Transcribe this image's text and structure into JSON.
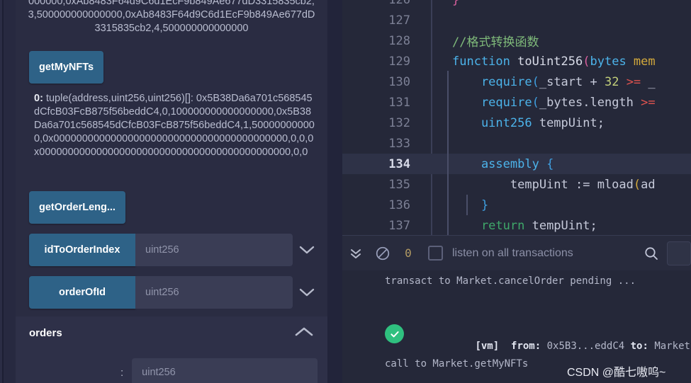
{
  "left_panel": {
    "top_result_text": "000000,0xAb8483F64d9C6d1EcF9b849Ae677dD3315835cb2,3,500000000000000,0xAb8483F64d9C6d1EcF9b849Ae677dD3315835cb2,4,500000000000000",
    "functions": [
      {
        "name": "getMyNFTs",
        "label": "getMyNFTs",
        "has_input": false,
        "has_chevron": false
      },
      {
        "name": "getOrderLength",
        "label": "getOrderLeng...",
        "has_input": false,
        "has_chevron": false
      },
      {
        "name": "idToOrderIndex",
        "label": "idToOrderIndex",
        "has_input": true,
        "input_placeholder": "uint256",
        "input_value": "",
        "has_chevron": true
      },
      {
        "name": "orderOfId",
        "label": "orderOfId",
        "has_input": true,
        "input_placeholder": "uint256",
        "input_value": "",
        "has_chevron": true
      }
    ],
    "getmynfts_return": {
      "index": "0:",
      "value": "tuple(address,uint256,uint256)[]: 0x5B38Da6a701c568545dCfcB03FcB875f56beddC4,0,100000000000000000,0x5B38Da6a701c568545dCfcB03FcB875f56beddC4,1,500000000000,0x00000000000000000000000000000000000000000,0,0,0x00000000000000000000000000000000000000000000,0,0"
    },
    "orders_section": {
      "title": "orders",
      "collapse_icon": "chevron-up-icon",
      "param_colon": ":",
      "param_placeholder": "uint256",
      "param_value": ""
    }
  },
  "editor": {
    "active_line": 134,
    "lines": [
      {
        "num": "126",
        "tokens": [
          {
            "t": "}",
            "c": "k-par2",
            "indent": 0
          }
        ]
      },
      {
        "num": "127",
        "tokens": []
      },
      {
        "num": "128",
        "tokens": [
          {
            "t": "//格式转换函数",
            "c": "k-cmt",
            "indent": 0
          }
        ]
      },
      {
        "num": "129",
        "tokens": [
          {
            "t": "function ",
            "c": "k-kw"
          },
          {
            "t": "toUint256",
            "c": "k-fn"
          },
          {
            "t": "(",
            "c": "k-par2"
          },
          {
            "t": "bytes ",
            "c": "k-type"
          },
          {
            "t": "mem",
            "c": "k-mem"
          }
        ]
      },
      {
        "num": "130",
        "tokens": [
          {
            "t": "    require",
            "c": "k-type"
          },
          {
            "t": "(",
            "c": "k-par"
          },
          {
            "t": "_start + ",
            "c": "k-punc"
          },
          {
            "t": "32",
            "c": "k-num"
          },
          {
            "t": " >=",
            "c": "k-op"
          },
          {
            "t": " _",
            "c": "k-punc"
          }
        ]
      },
      {
        "num": "131",
        "tokens": [
          {
            "t": "    require",
            "c": "k-type"
          },
          {
            "t": "(",
            "c": "k-par"
          },
          {
            "t": "_bytes.length",
            "c": "k-punc"
          },
          {
            "t": " >=",
            "c": "k-op"
          }
        ]
      },
      {
        "num": "132",
        "tokens": [
          {
            "t": "    uint256",
            "c": "k-type"
          },
          {
            "t": " tempUint;",
            "c": "k-punc"
          }
        ]
      },
      {
        "num": "133",
        "tokens": []
      },
      {
        "num": "134",
        "tokens": [
          {
            "t": "    assembly ",
            "c": "k-kw"
          },
          {
            "t": "{",
            "c": "k-par"
          }
        ]
      },
      {
        "num": "135",
        "tokens": [
          {
            "t": "        tempUint := mload",
            "c": "k-punc"
          },
          {
            "t": "(",
            "c": "k-par3"
          },
          {
            "t": "ad",
            "c": "k-punc"
          }
        ]
      },
      {
        "num": "136",
        "tokens": [
          {
            "t": "    }",
            "c": "k-par"
          }
        ]
      },
      {
        "num": "137",
        "tokens": [
          {
            "t": "    return",
            "c": "k-ret"
          },
          {
            "t": " tempUint;",
            "c": "k-punc"
          }
        ]
      }
    ]
  },
  "terminal": {
    "toolbar": {
      "collapse_icon": "chevrons-down-icon",
      "clear_icon": "ban-icon",
      "pending_count": "0",
      "listen_checkbox_checked": false,
      "listen_label": "listen on all transactions",
      "search_icon": "search-icon",
      "search_value": "",
      "search_placeholder": ""
    },
    "lines": [
      {
        "name": "pending-transaction",
        "text": "transact to Market.cancelOrder pending ..."
      },
      {
        "name": "vm-log",
        "status_icon": "check-circle-icon",
        "prefix": "[vm]",
        "from_label": "from:",
        "from_value": "0x5B3...eddC4",
        "to_label": "to:",
        "to_value": "Market.cance"
      },
      {
        "name": "call-log",
        "text": "call to Market.getMyNFTs"
      }
    ]
  },
  "watermark": {
    "text": "CSDN @酷七嗷呜~"
  }
}
